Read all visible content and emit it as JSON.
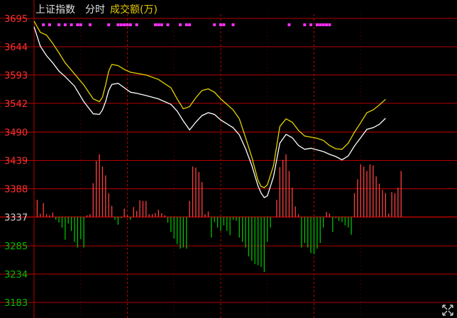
{
  "header": {
    "index_name": "上证指数",
    "mode_label": "分时",
    "indicator_label": "成交额(万)"
  },
  "colors": {
    "background": "#000000",
    "grid_red": "#b80000",
    "price_line": "#ffffff",
    "avg_line": "#e6d200",
    "bar_up": "#ff4040",
    "bar_down": "#00c000",
    "label_up": "#ff3030",
    "label_down": "#00c000",
    "label_base": "#d0d0d0",
    "header_text": "#e0e0e0",
    "indicator_text": "#e6c800",
    "dot_magenta": "#ff30ff"
  },
  "icons": {
    "corner": "expand-arrows-icon"
  },
  "chart_data": {
    "type": "line",
    "title": "上证指数 分时",
    "ylabel": "",
    "ylim": [
      3183,
      3695
    ],
    "baseline": 3337,
    "y_ticks": [
      "3695",
      "3644",
      "3593",
      "3542",
      "3490",
      "3439",
      "3388",
      "3337",
      "3285",
      "3234",
      "3183"
    ],
    "y_tick_values": [
      3695,
      3644,
      3593,
      3542,
      3490,
      3439,
      3388,
      3337,
      3285,
      3234,
      3183
    ],
    "x_range": [
      0,
      240
    ],
    "x_major_ticks": [
      60,
      120,
      180
    ],
    "x_minor_ticks": [
      30,
      90,
      150,
      210
    ],
    "series": [
      {
        "name": "price",
        "x": [
          0,
          4,
          8,
          12,
          16,
          20,
          26,
          32,
          38,
          42,
          44,
          46,
          48,
          50,
          54,
          58,
          62,
          66,
          72,
          80,
          88,
          92,
          96,
          100,
          104,
          108,
          112,
          116,
          120,
          124,
          128,
          132,
          136,
          140,
          144,
          146,
          148,
          150,
          154,
          158,
          162,
          166,
          170,
          174,
          178,
          182,
          186,
          190,
          194,
          198,
          202,
          206,
          210,
          214,
          218,
          222,
          226
        ],
        "values": [
          3680,
          3645,
          3628,
          3615,
          3600,
          3590,
          3573,
          3545,
          3523,
          3522,
          3530,
          3545,
          3565,
          3576,
          3578,
          3570,
          3562,
          3560,
          3556,
          3550,
          3540,
          3528,
          3510,
          3494,
          3508,
          3520,
          3525,
          3522,
          3512,
          3505,
          3498,
          3485,
          3460,
          3430,
          3393,
          3380,
          3372,
          3375,
          3410,
          3470,
          3486,
          3480,
          3466,
          3459,
          3461,
          3458,
          3455,
          3450,
          3446,
          3440,
          3447,
          3465,
          3480,
          3495,
          3498,
          3504,
          3515
        ]
      },
      {
        "name": "average",
        "x": [
          0,
          4,
          8,
          12,
          16,
          20,
          26,
          32,
          38,
          42,
          44,
          46,
          48,
          50,
          54,
          58,
          62,
          66,
          72,
          80,
          88,
          92,
          96,
          100,
          104,
          108,
          112,
          116,
          120,
          124,
          128,
          132,
          136,
          140,
          144,
          146,
          148,
          150,
          154,
          158,
          162,
          166,
          170,
          174,
          178,
          182,
          186,
          190,
          194,
          198,
          202,
          206,
          210,
          214,
          218,
          222,
          226
        ],
        "values": [
          3690,
          3670,
          3665,
          3650,
          3633,
          3615,
          3595,
          3575,
          3550,
          3545,
          3553,
          3575,
          3600,
          3612,
          3610,
          3603,
          3598,
          3596,
          3593,
          3585,
          3570,
          3550,
          3532,
          3536,
          3552,
          3565,
          3568,
          3562,
          3550,
          3540,
          3530,
          3514,
          3480,
          3445,
          3403,
          3392,
          3390,
          3395,
          3430,
          3500,
          3514,
          3508,
          3493,
          3483,
          3481,
          3479,
          3475,
          3466,
          3460,
          3459,
          3470,
          3490,
          3507,
          3525,
          3530,
          3539,
          3549
        ]
      }
    ],
    "volume": {
      "base": 3337,
      "bars": [
        {
          "x": 2,
          "v": 3368
        },
        {
          "x": 4,
          "v": 3343
        },
        {
          "x": 6,
          "v": 3362
        },
        {
          "x": 8,
          "v": 3342
        },
        {
          "x": 10,
          "v": 3340
        },
        {
          "x": 12,
          "v": 3345
        },
        {
          "x": 14,
          "v": 3332
        },
        {
          "x": 16,
          "v": 3327
        },
        {
          "x": 18,
          "v": 3318
        },
        {
          "x": 20,
          "v": 3296
        },
        {
          "x": 22,
          "v": 3325
        },
        {
          "x": 24,
          "v": 3312
        },
        {
          "x": 26,
          "v": 3292
        },
        {
          "x": 28,
          "v": 3282
        },
        {
          "x": 30,
          "v": 3297
        },
        {
          "x": 32,
          "v": 3282
        },
        {
          "x": 34,
          "v": 3340
        },
        {
          "x": 36,
          "v": 3342
        },
        {
          "x": 38,
          "v": 3398
        },
        {
          "x": 40,
          "v": 3438
        },
        {
          "x": 42,
          "v": 3450
        },
        {
          "x": 44,
          "v": 3428
        },
        {
          "x": 46,
          "v": 3412
        },
        {
          "x": 48,
          "v": 3380
        },
        {
          "x": 50,
          "v": 3357
        },
        {
          "x": 52,
          "v": 3332
        },
        {
          "x": 54,
          "v": 3323
        },
        {
          "x": 56,
          "v": 3335
        },
        {
          "x": 58,
          "v": 3352
        },
        {
          "x": 60,
          "v": 3340
        },
        {
          "x": 62,
          "v": 3332
        },
        {
          "x": 64,
          "v": 3355
        },
        {
          "x": 66,
          "v": 3348
        },
        {
          "x": 68,
          "v": 3367
        },
        {
          "x": 70,
          "v": 3366
        },
        {
          "x": 72,
          "v": 3366
        },
        {
          "x": 74,
          "v": 3342
        },
        {
          "x": 76,
          "v": 3342
        },
        {
          "x": 78,
          "v": 3344
        },
        {
          "x": 80,
          "v": 3350
        },
        {
          "x": 82,
          "v": 3344
        },
        {
          "x": 84,
          "v": 3340
        },
        {
          "x": 86,
          "v": 3327
        },
        {
          "x": 88,
          "v": 3310
        },
        {
          "x": 90,
          "v": 3298
        },
        {
          "x": 92,
          "v": 3288
        },
        {
          "x": 94,
          "v": 3280
        },
        {
          "x": 96,
          "v": 3282
        },
        {
          "x": 98,
          "v": 3280
        },
        {
          "x": 100,
          "v": 3366
        },
        {
          "x": 102,
          "v": 3428
        },
        {
          "x": 104,
          "v": 3426
        },
        {
          "x": 106,
          "v": 3418
        },
        {
          "x": 108,
          "v": 3400
        },
        {
          "x": 110,
          "v": 3342
        },
        {
          "x": 112,
          "v": 3347
        },
        {
          "x": 114,
          "v": 3300
        },
        {
          "x": 116,
          "v": 3328
        },
        {
          "x": 118,
          "v": 3318
        },
        {
          "x": 120,
          "v": 3312
        },
        {
          "x": 122,
          "v": 3322
        },
        {
          "x": 124,
          "v": 3312
        },
        {
          "x": 126,
          "v": 3304
        },
        {
          "x": 128,
          "v": 3332
        },
        {
          "x": 130,
          "v": 3330
        },
        {
          "x": 132,
          "v": 3300
        },
        {
          "x": 134,
          "v": 3292
        },
        {
          "x": 136,
          "v": 3282
        },
        {
          "x": 138,
          "v": 3266
        },
        {
          "x": 140,
          "v": 3258
        },
        {
          "x": 142,
          "v": 3252
        },
        {
          "x": 144,
          "v": 3250
        },
        {
          "x": 146,
          "v": 3247
        },
        {
          "x": 148,
          "v": 3238
        },
        {
          "x": 150,
          "v": 3292
        },
        {
          "x": 152,
          "v": 3318
        },
        {
          "x": 154,
          "v": 3337
        },
        {
          "x": 156,
          "v": 3368
        },
        {
          "x": 158,
          "v": 3427
        },
        {
          "x": 160,
          "v": 3440
        },
        {
          "x": 162,
          "v": 3450
        },
        {
          "x": 164,
          "v": 3420
        },
        {
          "x": 166,
          "v": 3390
        },
        {
          "x": 168,
          "v": 3356
        },
        {
          "x": 170,
          "v": 3342
        },
        {
          "x": 172,
          "v": 3282
        },
        {
          "x": 174,
          "v": 3290
        },
        {
          "x": 176,
          "v": 3282
        },
        {
          "x": 178,
          "v": 3272
        },
        {
          "x": 180,
          "v": 3270
        },
        {
          "x": 182,
          "v": 3280
        },
        {
          "x": 184,
          "v": 3290
        },
        {
          "x": 186,
          "v": 3318
        },
        {
          "x": 188,
          "v": 3346
        },
        {
          "x": 190,
          "v": 3343
        },
        {
          "x": 192,
          "v": 3310
        },
        {
          "x": 194,
          "v": 3335
        },
        {
          "x": 196,
          "v": 3330
        },
        {
          "x": 198,
          "v": 3328
        },
        {
          "x": 200,
          "v": 3322
        },
        {
          "x": 202,
          "v": 3318
        },
        {
          "x": 204,
          "v": 3305
        },
        {
          "x": 206,
          "v": 3380
        },
        {
          "x": 208,
          "v": 3405
        },
        {
          "x": 210,
          "v": 3432
        },
        {
          "x": 212,
          "v": 3428
        },
        {
          "x": 214,
          "v": 3420
        },
        {
          "x": 216,
          "v": 3432
        },
        {
          "x": 218,
          "v": 3430
        },
        {
          "x": 220,
          "v": 3410
        },
        {
          "x": 222,
          "v": 3397
        },
        {
          "x": 224,
          "v": 3386
        },
        {
          "x": 226,
          "v": 3380
        },
        {
          "x": 228,
          "v": 3343
        },
        {
          "x": 230,
          "v": 3382
        },
        {
          "x": 232,
          "v": 3380
        },
        {
          "x": 234,
          "v": 3390
        },
        {
          "x": 236,
          "v": 3420
        }
      ]
    },
    "dots_x": [
      6,
      10,
      16,
      20,
      24,
      28,
      30,
      36,
      48,
      54,
      56,
      58,
      60,
      62,
      66,
      78,
      80,
      82,
      86,
      94,
      98,
      100,
      116,
      120,
      122,
      128,
      164,
      174,
      178,
      182,
      184,
      186,
      188,
      190
    ]
  }
}
